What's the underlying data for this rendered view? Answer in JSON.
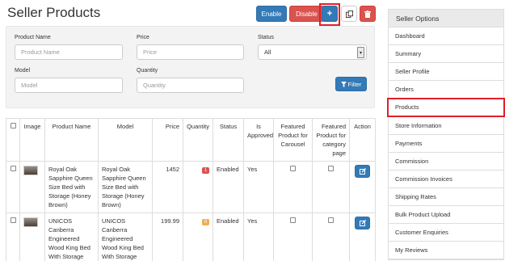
{
  "page": {
    "title": "Seller Products"
  },
  "toolbar": {
    "enable_label": "Enable",
    "disable_label": "Disable",
    "add_label": "+",
    "copy_icon": "copy-icon",
    "delete_icon": "trash-icon"
  },
  "filter": {
    "product_name": {
      "label": "Product Name",
      "placeholder": "Product Name"
    },
    "price": {
      "label": "Price",
      "placeholder": "Price"
    },
    "status": {
      "label": "Status",
      "value": "All"
    },
    "model": {
      "label": "Model",
      "placeholder": "Model"
    },
    "quantity": {
      "label": "Quantity",
      "placeholder": "Quantity"
    },
    "button_label": "Filter"
  },
  "table": {
    "headers": {
      "image": "Image",
      "product_name": "Product Name",
      "model": "Model",
      "price": "Price",
      "quantity": "Quantity",
      "status": "Status",
      "is_approved": "Is Approved",
      "featured_carousel": "Featured Product for Carousel",
      "featured_category": "Featured Product for category page",
      "action": "Action"
    },
    "rows": [
      {
        "product_name": "Royal Oak Sapphire Queen Size Bed with Storage (Honey Brown)",
        "model": "Royal Oak Sapphire Queen Size Bed with Storage (Honey Brown)",
        "price": "1452",
        "quantity": "1",
        "quantity_color": "#d9534f",
        "status": "Enabled",
        "is_approved": "Yes"
      },
      {
        "product_name": "UNICOS Canberra Engineered Wood King Bed With Storage",
        "model": "UNICOS Canberra Engineered Wood King Bed With Storage",
        "price": "199.99",
        "quantity": "0",
        "quantity_color": "#f0ad4e",
        "status": "Enabled",
        "is_approved": "Yes"
      }
    ]
  },
  "sidebar": {
    "title": "Seller Options",
    "items": [
      {
        "label": "Dashboard"
      },
      {
        "label": "Summary"
      },
      {
        "label": "Seller Profile"
      },
      {
        "label": "Orders"
      },
      {
        "label": "Products"
      },
      {
        "label": "Store Information"
      },
      {
        "label": "Payments"
      },
      {
        "label": "Commission"
      },
      {
        "label": "Commission Invoices"
      },
      {
        "label": "Shipping Rates"
      },
      {
        "label": "Bulk Product Upload"
      },
      {
        "label": "Customer Enquiries"
      },
      {
        "label": "My Reviews"
      }
    ]
  },
  "colors": {
    "primary": "#337ab7",
    "danger": "#d9534f",
    "warning": "#f0ad4e",
    "highlight": "#e0202a"
  }
}
